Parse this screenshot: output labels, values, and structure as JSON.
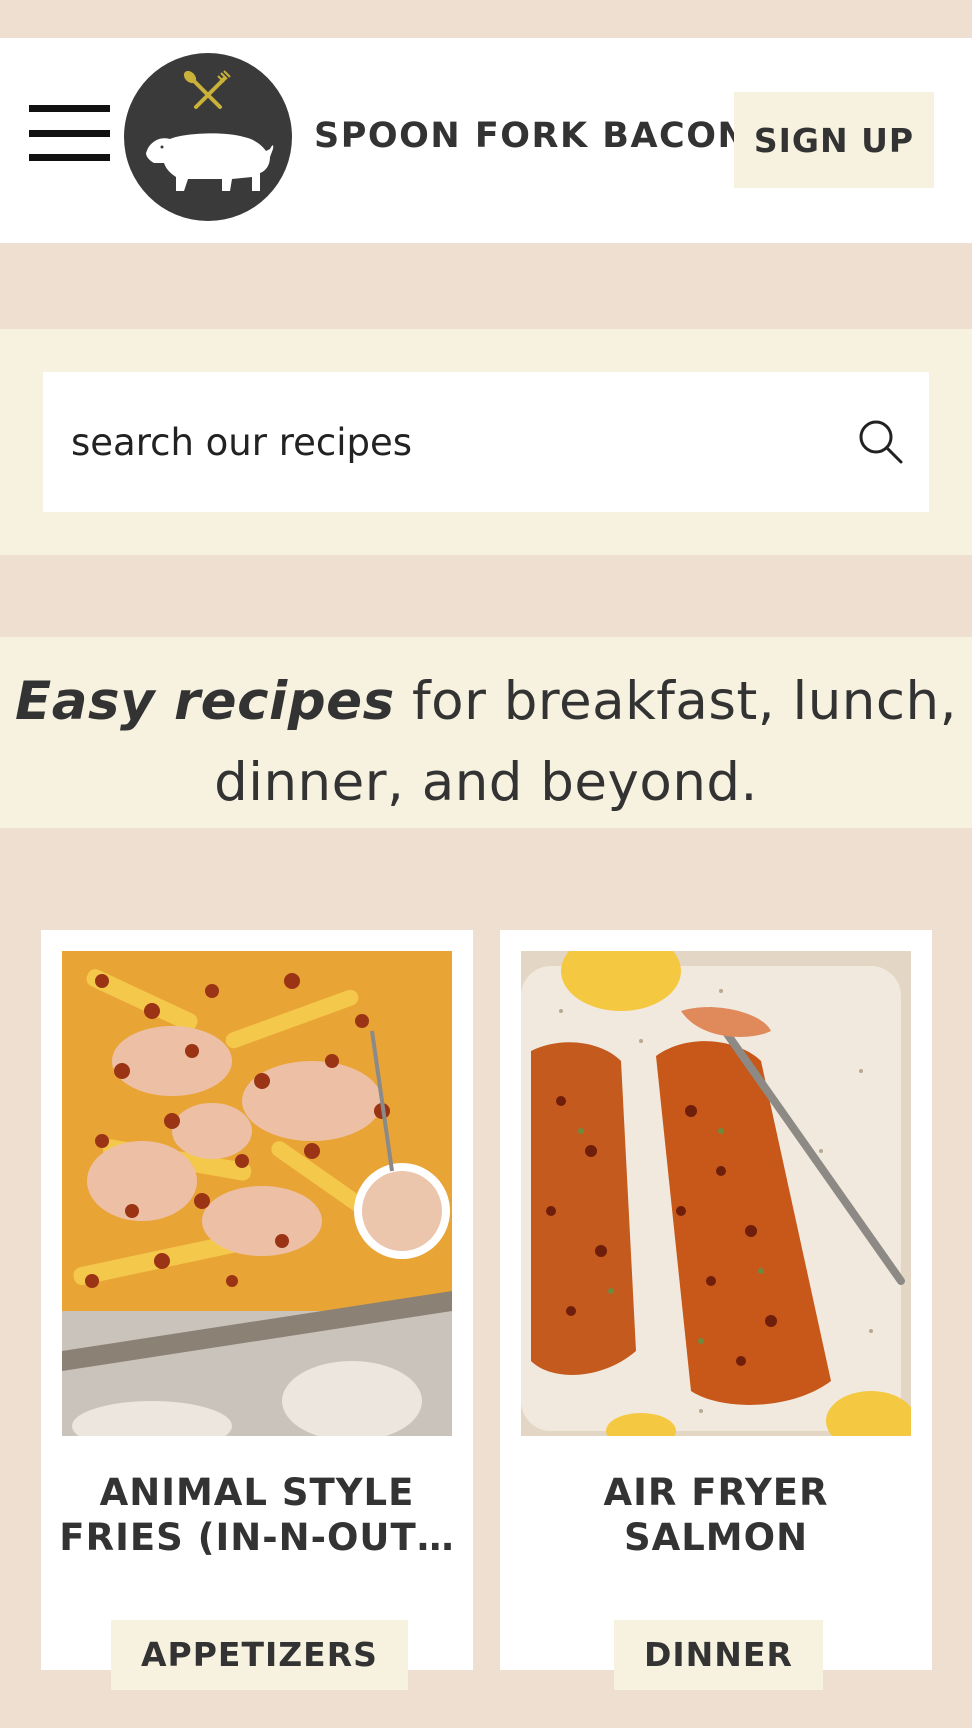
{
  "header": {
    "menu_icon": "hamburger-menu-icon",
    "logo_icon": "pig-fork-spoon-logo",
    "brand_name": "SPOON FORK BACON",
    "signup_label": "SIGN UP"
  },
  "search": {
    "placeholder": "search our recipes",
    "icon": "search-icon"
  },
  "tagline": {
    "emphasis": "Easy recipes",
    "rest": "for breakfast, lunch, dinner, and beyond."
  },
  "recipes": [
    {
      "title": "ANIMAL STYLE FRIES (IN-N-OUT…",
      "category": "APPETIZERS"
    },
    {
      "title": "AIR FRYER SALMON",
      "category": "DINNER"
    }
  ],
  "colors": {
    "page_bg": "#efdfd1",
    "band_bg": "#f6f2df",
    "card_bg": "#ffffff",
    "text": "#333333",
    "logo_bg": "#3a3a3a",
    "logo_accent": "#c9b13a"
  }
}
